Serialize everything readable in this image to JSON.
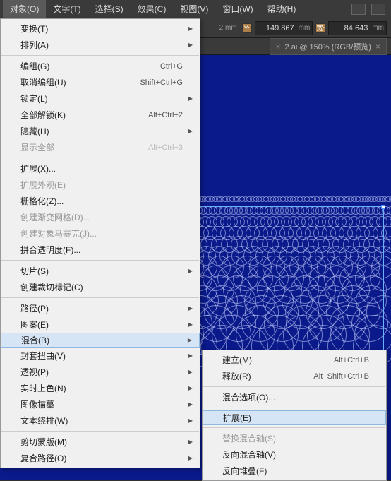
{
  "menubar": {
    "items": [
      "对象(O)",
      "文字(T)",
      "选择(S)",
      "效果(C)",
      "视图(V)",
      "窗口(W)",
      "帮助(H)"
    ]
  },
  "propbar": {
    "y_value": "149.867",
    "w_value": "84.643",
    "unit": "mm",
    "x_suffix": "2 mm",
    "y_label": "Y:",
    "w_label": "宽:"
  },
  "tab": {
    "label": "2.ai @ 150% (RGB/预览)",
    "close": "×"
  },
  "menu_object": [
    {
      "label": "变换(T)",
      "sub": true
    },
    {
      "label": "排列(A)",
      "sub": true
    },
    {
      "sep": true
    },
    {
      "label": "编组(G)",
      "shortcut": "Ctrl+G"
    },
    {
      "label": "取消编组(U)",
      "shortcut": "Shift+Ctrl+G"
    },
    {
      "label": "锁定(L)",
      "sub": true
    },
    {
      "label": "全部解锁(K)",
      "shortcut": "Alt+Ctrl+2"
    },
    {
      "label": "隐藏(H)",
      "sub": true
    },
    {
      "label": "显示全部",
      "shortcut": "Alt+Ctrl+3",
      "dis": true
    },
    {
      "sep": true
    },
    {
      "label": "扩展(X)..."
    },
    {
      "label": "扩展外观(E)",
      "dis": true
    },
    {
      "label": "栅格化(Z)..."
    },
    {
      "label": "创建渐变网格(D)...",
      "dis": true
    },
    {
      "label": "创建对象马赛克(J)...",
      "dis": true
    },
    {
      "label": "拼合透明度(F)..."
    },
    {
      "sep": true
    },
    {
      "label": "切片(S)",
      "sub": true
    },
    {
      "label": "创建裁切标记(C)"
    },
    {
      "sep": true
    },
    {
      "label": "路径(P)",
      "sub": true
    },
    {
      "label": "图案(E)",
      "sub": true
    },
    {
      "label": "混合(B)",
      "sub": true,
      "hi": true
    },
    {
      "label": "封套扭曲(V)",
      "sub": true
    },
    {
      "label": "透视(P)",
      "sub": true
    },
    {
      "label": "实时上色(N)",
      "sub": true
    },
    {
      "label": "图像描摹",
      "sub": true
    },
    {
      "label": "文本绕排(W)",
      "sub": true
    },
    {
      "sep": true
    },
    {
      "label": "剪切蒙版(M)",
      "sub": true
    },
    {
      "label": "复合路径(O)",
      "sub": true
    }
  ],
  "menu_blend": [
    {
      "label": "建立(M)",
      "shortcut": "Alt+Ctrl+B"
    },
    {
      "label": "释放(R)",
      "shortcut": "Alt+Shift+Ctrl+B"
    },
    {
      "sep": true
    },
    {
      "label": "混合选项(O)..."
    },
    {
      "sep": true
    },
    {
      "label": "扩展(E)",
      "hi": true
    },
    {
      "sep": true
    },
    {
      "label": "替换混合轴(S)",
      "dis": true
    },
    {
      "label": "反向混合轴(V)"
    },
    {
      "label": "反向堆叠(F)"
    }
  ]
}
